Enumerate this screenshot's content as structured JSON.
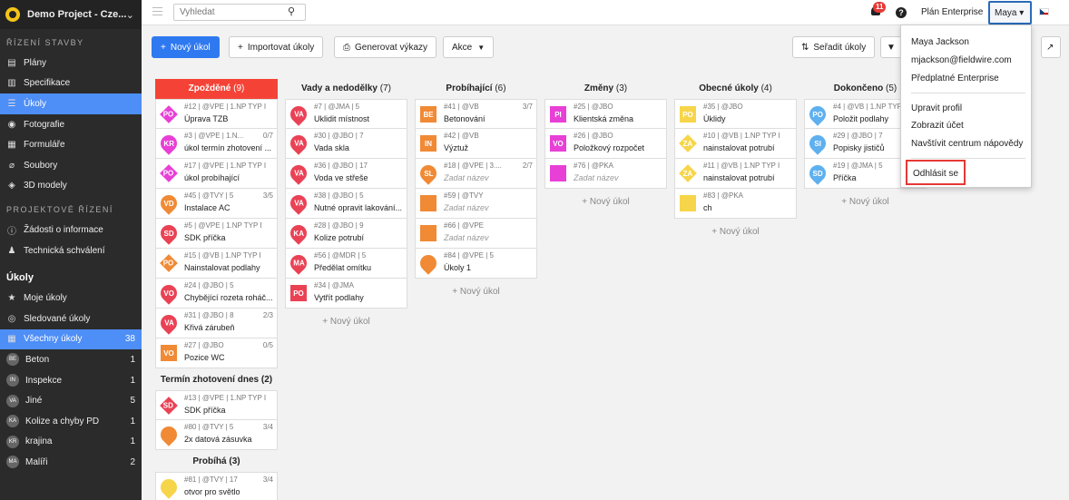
{
  "project": {
    "name": "Demo Project - Cze..."
  },
  "sidebar": {
    "section1": "ŘÍZENÍ STAVBY",
    "items1": [
      {
        "label": "Plány",
        "icon": "map-icon"
      },
      {
        "label": "Specifikace",
        "icon": "book-icon"
      },
      {
        "label": "Úkoly",
        "icon": "list-icon"
      },
      {
        "label": "Fotografie",
        "icon": "camera-icon"
      },
      {
        "label": "Formuláře",
        "icon": "form-icon"
      },
      {
        "label": "Soubory",
        "icon": "paperclip-icon"
      },
      {
        "label": "3D modely",
        "icon": "cube-icon"
      }
    ],
    "section2": "PROJEKTOVÉ ŘÍZENÍ",
    "items2": [
      {
        "label": "Žádosti o informace",
        "icon": "info-icon"
      },
      {
        "label": "Technická schválení",
        "icon": "stamp-icon"
      }
    ],
    "section3": "Úkoly",
    "items3": [
      {
        "label": "Moje úkoly",
        "icon": "star-icon",
        "count": ""
      },
      {
        "label": "Sledované úkoly",
        "icon": "eye-icon",
        "count": ""
      },
      {
        "label": "Všechny úkoly",
        "icon": "grid-icon",
        "count": "38"
      }
    ],
    "cats": [
      {
        "abbr": "BE",
        "label": "Beton",
        "count": "1"
      },
      {
        "abbr": "IN",
        "label": "Inspekce",
        "count": "1"
      },
      {
        "abbr": "VA",
        "label": "Jiné",
        "count": "5"
      },
      {
        "abbr": "KA",
        "label": "Kolize a chyby PD",
        "count": "1"
      },
      {
        "abbr": "KR",
        "label": "krajina",
        "count": "1"
      },
      {
        "abbr": "MA",
        "label": "Malíři",
        "count": "2"
      }
    ]
  },
  "topbar": {
    "search_placeholder": "Vyhledat",
    "notifications": "11",
    "help": "?",
    "plan": "Plán Enterprise",
    "user": "Maya ▾"
  },
  "toolbar": {
    "new_task": "Nový úkol",
    "import": "Importovat úkoly",
    "reports": "Generovat výkazy",
    "actions": "Akce",
    "sort": "Seřadit úkoly"
  },
  "menu": {
    "name": "Maya Jackson",
    "email": "mjackson@fieldwire.com",
    "sub": "Předplatné Enterprise",
    "edit": "Upravit profil",
    "account": "Zobrazit účet",
    "help": "Navštívit centrum nápovědy",
    "logout": "Odhlásit se"
  },
  "board": {
    "new_task": "+ Nový úkol",
    "columns": [
      {
        "title": "Zpožděné",
        "count": "(9)",
        "cards": [
          {
            "abbr": "PO",
            "color": "#e83fd6",
            "shape": "dia",
            "meta": "#12 | @VPE | 1.NP TYP I",
            "right": "",
            "title": "Úprava TZB"
          },
          {
            "abbr": "KR",
            "color": "#e83fd6",
            "shape": "pin",
            "meta": "#3 | @VPE | 1.N...",
            "right": "0/7",
            "title": "úkol termín zhotovení ..."
          },
          {
            "abbr": "PO",
            "color": "#e83fd6",
            "shape": "dia",
            "meta": "#17 | @VPE | 1.NP TYP I",
            "right": "",
            "title": "úkol probíhající"
          },
          {
            "abbr": "VD",
            "color": "#f08a35",
            "shape": "pin",
            "meta": "#45 | @TVY | 5",
            "right": "3/5",
            "title": "Instalace AC"
          },
          {
            "abbr": "SD",
            "color": "#ea4255",
            "shape": "pin",
            "meta": "#5 | @VPE | 1.NP TYP I",
            "right": "",
            "title": "SDK příčka"
          },
          {
            "abbr": "PO",
            "color": "#f08a35",
            "shape": "dia",
            "meta": "#15 | @VB | 1.NP TYP I",
            "right": "",
            "title": "Nainstalovat podlahy"
          },
          {
            "abbr": "VO",
            "color": "#ea4255",
            "shape": "pin",
            "meta": "#24 | @JBO | 5",
            "right": "",
            "title": "Chybějící rozeta roháč..."
          },
          {
            "abbr": "VA",
            "color": "#ea4255",
            "shape": "pin",
            "meta": "#31 | @JBO | 8",
            "right": "2/3",
            "title": "Křivá zárubeň"
          },
          {
            "abbr": "VO",
            "color": "#f08a35",
            "shape": "sq",
            "meta": "#27 | @JBO",
            "right": "0/5",
            "title": "Pozice WC"
          }
        ],
        "sub": [
          {
            "title": "Termín zhotovení dnes",
            "count": "(2)",
            "cards": [
              {
                "abbr": "SD",
                "color": "#ea4255",
                "shape": "dia",
                "meta": "#13 | @VPE | 1.NP TYP I",
                "right": "",
                "title": "SDK příčka"
              },
              {
                "abbr": "",
                "color": "#f08a35",
                "shape": "pin",
                "meta": "#80 | @TVY | 5",
                "right": "3/4",
                "title": "2x datová zásuvka"
              }
            ]
          },
          {
            "title": "Probíhá",
            "count": "(3)",
            "cards": [
              {
                "abbr": "",
                "color": "#f7d54a",
                "shape": "pin",
                "meta": "#81 | @TVY | 17",
                "right": "3/4",
                "title": "otvor pro světlo"
              }
            ]
          }
        ]
      },
      {
        "title": "Vady a nedodělky",
        "count": "(7)",
        "cards": [
          {
            "abbr": "VA",
            "color": "#ea4255",
            "shape": "pin",
            "meta": "#7 | @JMA | 5",
            "right": "",
            "title": "Uklidit místnost"
          },
          {
            "abbr": "VA",
            "color": "#ea4255",
            "shape": "pin",
            "meta": "#30 | @JBO | 7",
            "right": "",
            "title": "Vada skla"
          },
          {
            "abbr": "VA",
            "color": "#ea4255",
            "shape": "pin",
            "meta": "#36 | @JBO | 17",
            "right": "",
            "title": "Voda ve střeše"
          },
          {
            "abbr": "VA",
            "color": "#ea4255",
            "shape": "pin",
            "meta": "#38 | @JBO | 5",
            "right": "",
            "title": "Nutné opravit lakování..."
          },
          {
            "abbr": "KA",
            "color": "#ea4255",
            "shape": "pin",
            "meta": "#28 | @JBO | 9",
            "right": "",
            "title": "Kolize potrubí"
          },
          {
            "abbr": "MA",
            "color": "#ea4255",
            "shape": "pin",
            "meta": "#56 | @MDR | 5",
            "right": "",
            "title": "Předělat omítku"
          },
          {
            "abbr": "PO",
            "color": "#ea4255",
            "shape": "sq",
            "meta": "#34 | @JMA",
            "right": "",
            "title": "Vytřít podlahy"
          }
        ]
      },
      {
        "title": "Probíhající",
        "count": "(6)",
        "cards": [
          {
            "abbr": "BE",
            "color": "#f08a35",
            "shape": "sq",
            "meta": "#41 | @VB",
            "right": "3/7",
            "title": "Betonování"
          },
          {
            "abbr": "IN",
            "color": "#f08a35",
            "shape": "sq",
            "meta": "#42 | @VB",
            "right": "",
            "title": "Výztuž"
          },
          {
            "abbr": "SL",
            "color": "#f08a35",
            "shape": "pin",
            "meta": "#18 | @VPE | 3....",
            "right": "2/7",
            "title": "Zadat název",
            "ph": true
          },
          {
            "abbr": "",
            "color": "#f08a35",
            "shape": "sq",
            "meta": "#59 | @TVY",
            "right": "",
            "title": "Zadat název",
            "ph": true
          },
          {
            "abbr": "",
            "color": "#f08a35",
            "shape": "sq",
            "meta": "#66 | @VPE",
            "right": "",
            "title": "Zadat název",
            "ph": true
          },
          {
            "abbr": "",
            "color": "#f08a35",
            "shape": "pin",
            "meta": "#84 | @VPE | 5",
            "right": "",
            "title": "Úkoly 1"
          }
        ]
      },
      {
        "title": "Změny",
        "count": "(3)",
        "cards": [
          {
            "abbr": "PI",
            "color": "#e83fd6",
            "shape": "sq",
            "meta": "#25 | @JBO",
            "right": "",
            "title": "Klientská změna"
          },
          {
            "abbr": "VO",
            "color": "#e83fd6",
            "shape": "sq",
            "meta": "#26 | @JBO",
            "right": "",
            "title": "Položkový rozpočet"
          },
          {
            "abbr": "",
            "color": "#e83fd6",
            "shape": "sq",
            "meta": "#76 | @PKA",
            "right": "",
            "title": "Zadat název",
            "ph": true
          }
        ]
      },
      {
        "title": "Obecné úkoly",
        "count": "(4)",
        "cards": [
          {
            "abbr": "PO",
            "color": "#f7d54a",
            "shape": "sq",
            "meta": "#35 | @JBO",
            "right": "",
            "title": "Úklidy"
          },
          {
            "abbr": "ZA",
            "color": "#f7d54a",
            "shape": "dia",
            "meta": "#10 | @VB | 1.NP TYP I",
            "right": "",
            "title": "nainstalovat potrubí"
          },
          {
            "abbr": "ZA",
            "color": "#f7d54a",
            "shape": "dia",
            "meta": "#11 | @VB | 1.NP TYP I",
            "right": "",
            "title": "nainstalovat potrubí"
          },
          {
            "abbr": "",
            "color": "#f7d54a",
            "shape": "sq",
            "meta": "#83 | @PKA",
            "right": "",
            "title": "ch"
          }
        ]
      },
      {
        "title": "Dokončeno",
        "count": "(5)",
        "cards": [
          {
            "abbr": "PO",
            "color": "#5eb0ef",
            "shape": "pin",
            "meta": "#4 | @VB | 1.NP TYP I",
            "right": "4/5",
            "title": "Položit podlahy"
          },
          {
            "abbr": "SI",
            "color": "#5eb0ef",
            "shape": "pin",
            "meta": "#29 | @JBO | 7",
            "right": "",
            "title": "Popisky jističů"
          },
          {
            "abbr": "SD",
            "color": "#5eb0ef",
            "shape": "pin",
            "meta": "#19 | @JMA | 5",
            "right": "",
            "title": "Příčka"
          }
        ]
      }
    ]
  }
}
